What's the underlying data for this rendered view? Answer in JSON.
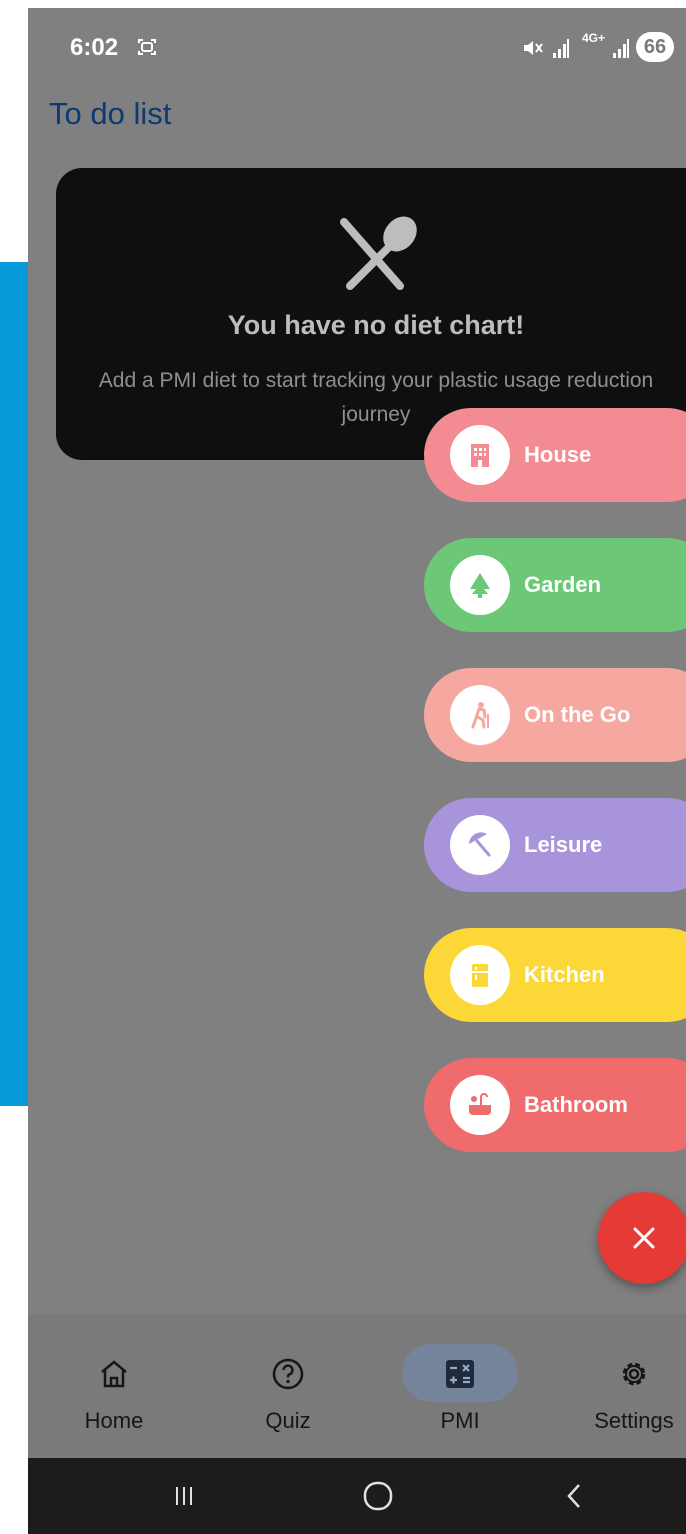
{
  "status_bar": {
    "time": "6:02",
    "network_type": "4G+",
    "battery": "66",
    "icons": [
      "screen-record-icon",
      "mute-icon",
      "signal-icon",
      "signal-icon"
    ]
  },
  "page": {
    "title": "To do list"
  },
  "empty_state": {
    "icon": "fork-spoon-icon",
    "title": "You have no diet chart!",
    "description": "Add a PMI diet to start tracking your plastic usage reduction journey"
  },
  "speed_dial": {
    "items": [
      {
        "label": "House",
        "icon": "building-icon",
        "color": "#f38b93"
      },
      {
        "label": "Garden",
        "icon": "tree-icon",
        "color": "#6cc876"
      },
      {
        "label": "On the Go",
        "icon": "hiker-icon",
        "color": "#f6a7a0"
      },
      {
        "label": "Leisure",
        "icon": "beach-umbrella-icon",
        "color": "#a794db"
      },
      {
        "label": "Kitchen",
        "icon": "fridge-icon",
        "color": "#fbd737"
      },
      {
        "label": "Bathroom",
        "icon": "bathtub-icon",
        "color": "#f06b6b"
      }
    ],
    "close_icon": "close-icon",
    "close_color": "#e53a35"
  },
  "bottom_nav": {
    "items": [
      {
        "label": "Home",
        "icon": "home-icon",
        "active": false
      },
      {
        "label": "Quiz",
        "icon": "question-circle-icon",
        "active": false
      },
      {
        "label": "PMI",
        "icon": "calculator-icon",
        "active": true
      },
      {
        "label": "Settings",
        "icon": "gear-icon",
        "active": false
      }
    ]
  },
  "system_nav": {
    "buttons": [
      "recents-icon",
      "home-circle-icon",
      "back-icon"
    ]
  }
}
